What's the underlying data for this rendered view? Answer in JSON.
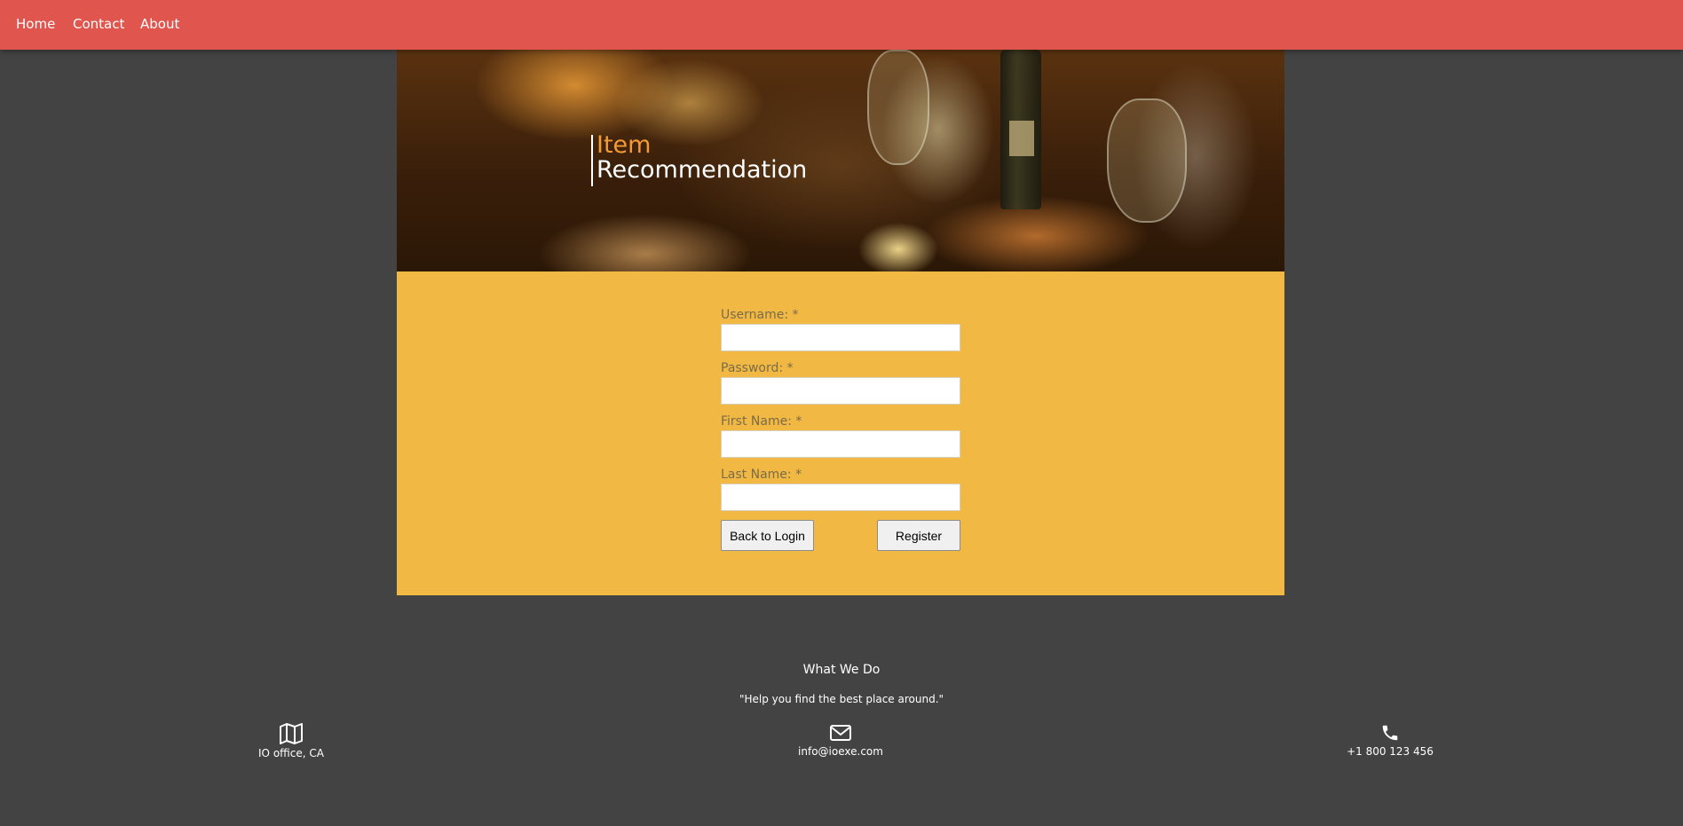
{
  "nav": {
    "items": [
      {
        "label": "Home"
      },
      {
        "label": "Contact"
      },
      {
        "label": "About"
      }
    ]
  },
  "hero": {
    "title_line1": "Item",
    "title_line2": "Recommendation"
  },
  "form": {
    "username": {
      "label": "Username: *",
      "value": ""
    },
    "password": {
      "label": "Password: *",
      "value": ""
    },
    "first_name": {
      "label": "First Name: *",
      "value": ""
    },
    "last_name": {
      "label": "Last Name: *",
      "value": ""
    },
    "back_label": "Back to Login",
    "register_label": "Register"
  },
  "footer": {
    "heading": "What We Do",
    "quote": "\"Help you find the best place around.\"",
    "address": {
      "icon": "map-icon",
      "text": "IO office, CA"
    },
    "email": {
      "icon": "envelope-icon",
      "text": "info@ioexe.com"
    },
    "phone": {
      "icon": "phone-icon",
      "text": "+1 800 123 456"
    }
  },
  "colors": {
    "nav_bg": "#e0554d",
    "page_bg": "#434343",
    "panel_bg": "#f2b844",
    "title_accent": "#f39a35"
  }
}
